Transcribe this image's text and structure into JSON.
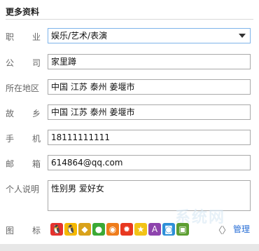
{
  "section": {
    "title": "更多资料"
  },
  "fields": {
    "occupation": {
      "label_a": "职",
      "label_b": "业",
      "value": "娱乐/艺术/表演"
    },
    "company": {
      "label_a": "公",
      "label_b": "司",
      "value": "家里蹲"
    },
    "location": {
      "label": "所在地区",
      "value": "中国  江苏  泰州  姜堰市"
    },
    "hometown": {
      "label_a": "故",
      "label_b": "乡",
      "value": "中国  江苏  泰州  姜堰市"
    },
    "mobile": {
      "label_a": "手",
      "label_b": "机",
      "value": "18111111111"
    },
    "email": {
      "label_a": "邮",
      "label_b": "箱",
      "value": "614864@qq.com"
    },
    "bio": {
      "label": "个人说明",
      "value": "性别男 爱好女"
    }
  },
  "icons": {
    "label_a": "图",
    "label_b": "标",
    "items": [
      {
        "name": "qq-penguin-colorful-icon",
        "color": "#e5322d",
        "glyph": "🐧"
      },
      {
        "name": "qq-penguin-icon",
        "color": "#f5b800",
        "glyph": "🐧"
      },
      {
        "name": "gold-badge-icon",
        "color": "#d9a21b",
        "glyph": "◆"
      },
      {
        "name": "green-badge-icon",
        "color": "#3ba935",
        "glyph": "●"
      },
      {
        "name": "orange-flame-icon",
        "color": "#ef7c1b",
        "glyph": "◉"
      },
      {
        "name": "red-sun-icon",
        "color": "#e8381f",
        "glyph": "✹"
      },
      {
        "name": "yellow-star-icon",
        "color": "#f2c316",
        "glyph": "★"
      },
      {
        "name": "app-icon",
        "color": "#8e44ad",
        "glyph": "A"
      },
      {
        "name": "camera-icon",
        "color": "#2d8fd8",
        "glyph": "◙"
      },
      {
        "name": "game-icon",
        "color": "#5c9e32",
        "glyph": "▣"
      }
    ],
    "prev": "〈",
    "next": "〉",
    "manage": "管理"
  },
  "watermark": "系统网",
  "colors": {
    "link": "#2a6fd6",
    "focus_border": "#7eb4ea"
  }
}
